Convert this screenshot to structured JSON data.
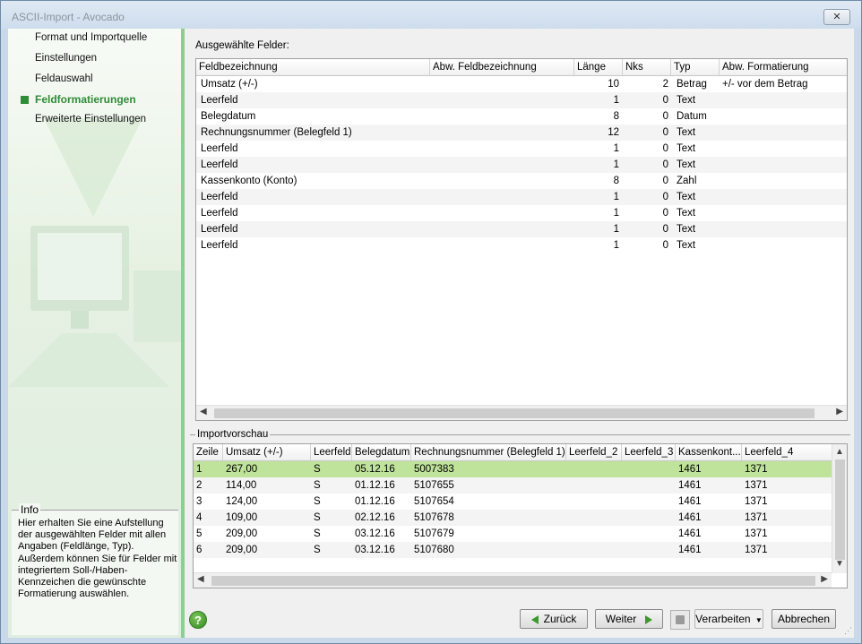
{
  "window": {
    "title": "ASCII-Import - Avocado",
    "close_glyph": "✕"
  },
  "nav": {
    "items": [
      {
        "label": "Format und Importquelle"
      },
      {
        "label": "Einstellungen"
      },
      {
        "label": "Feldauswahl"
      },
      {
        "label": "Feldformatierungen"
      },
      {
        "label": "Erweiterte Einstellungen"
      }
    ],
    "active_index": 3
  },
  "info": {
    "title": "Info",
    "text": "Hier erhalten Sie eine Aufstellung der ausgewählten Felder mit allen Angaben (Feldlänge, Typ). Außerdem können Sie für Felder mit integriertem Soll-/Haben-Kennzeichen die gewünschte Formatierung auswählen."
  },
  "fields": {
    "label": "Ausgewählte Felder:",
    "columns": [
      "Feldbezeichnung",
      "Abw. Feldbezeichnung",
      "Länge",
      "Nks",
      "Typ",
      "Abw. Formatierung"
    ],
    "rows": [
      [
        "Umsatz (+/-)",
        "",
        "10",
        "2",
        "Betrag",
        "+/- vor dem Betrag"
      ],
      [
        "Leerfeld",
        "",
        "1",
        "0",
        "Text",
        ""
      ],
      [
        "Belegdatum",
        "",
        "8",
        "0",
        "Datum",
        ""
      ],
      [
        "Rechnungsnummer (Belegfeld 1)",
        "",
        "12",
        "0",
        "Text",
        ""
      ],
      [
        "Leerfeld",
        "",
        "1",
        "0",
        "Text",
        ""
      ],
      [
        "Leerfeld",
        "",
        "1",
        "0",
        "Text",
        ""
      ],
      [
        "Kassenkonto (Konto)",
        "",
        "8",
        "0",
        "Zahl",
        ""
      ],
      [
        "Leerfeld",
        "",
        "1",
        "0",
        "Text",
        ""
      ],
      [
        "Leerfeld",
        "",
        "1",
        "0",
        "Text",
        ""
      ],
      [
        "Leerfeld",
        "",
        "1",
        "0",
        "Text",
        ""
      ],
      [
        "Leerfeld",
        "",
        "1",
        "0",
        "Text",
        ""
      ]
    ]
  },
  "preview": {
    "label": "Importvorschau",
    "columns": [
      "Zeile",
      "Umsatz (+/-)",
      "Leerfeld",
      "Belegdatum",
      "Rechnungsnummer (Belegfeld 1)",
      "Leerfeld_2",
      "Leerfeld_3",
      "Kassenkont...",
      "Leerfeld_4"
    ],
    "rows": [
      [
        "1",
        "267,00",
        "S",
        "05.12.16",
        "5007383",
        "",
        "",
        "1461",
        "1371"
      ],
      [
        "2",
        "114,00",
        "S",
        "01.12.16",
        "5107655",
        "",
        "",
        "1461",
        "1371"
      ],
      [
        "3",
        "124,00",
        "S",
        "01.12.16",
        "5107654",
        "",
        "",
        "1461",
        "1371"
      ],
      [
        "4",
        "109,00",
        "S",
        "02.12.16",
        "5107678",
        "",
        "",
        "1461",
        "1371"
      ],
      [
        "5",
        "209,00",
        "S",
        "03.12.16",
        "5107679",
        "",
        "",
        "1461",
        "1371"
      ],
      [
        "6",
        "209,00",
        "S",
        "03.12.16",
        "5107680",
        "",
        "",
        "1461",
        "1371"
      ]
    ],
    "selected_row": 0
  },
  "buttons": {
    "help": "?",
    "back": "Zurück",
    "next": "Weiter",
    "process": "Verarbeiten",
    "cancel": "Abbrechen"
  },
  "colors": {
    "accent": "#2e8b38",
    "selection": "#bfe39a"
  }
}
